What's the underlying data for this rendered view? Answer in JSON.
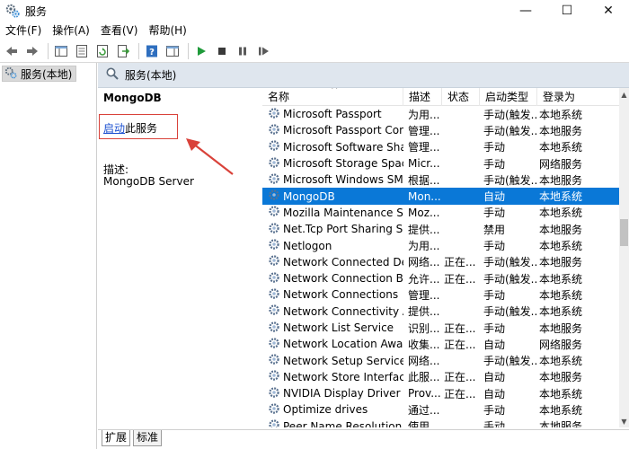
{
  "window": {
    "title": "服务"
  },
  "window_controls": {
    "minimize": "—",
    "maximize": "☐",
    "close": "✕"
  },
  "menu": [
    "文件(F)",
    "操作(A)",
    "查看(V)",
    "帮助(H)"
  ],
  "toolbar": {
    "icons": [
      "back-icon",
      "forward-icon",
      "show-tree-icon",
      "properties-icon",
      "refresh-icon",
      "export-icon",
      "help-icon",
      "show-panel-icon",
      "start-icon",
      "stop-icon",
      "pause-icon",
      "restart-icon"
    ]
  },
  "tree": {
    "root_label": "服务(本地)"
  },
  "pane": {
    "header_label": "服务(本地)"
  },
  "description": {
    "service_name": "MongoDB",
    "action_link": "启动",
    "action_suffix": "此服务",
    "desc_label": "描述:",
    "desc_value": "MongoDB Server"
  },
  "table": {
    "columns": [
      "名称",
      "描述",
      "状态",
      "启动类型",
      "登录为"
    ],
    "rows": [
      {
        "name": "Microsoft Passport",
        "desc": "为用...",
        "status": "",
        "start": "手动(触发...",
        "logon": "本地系统"
      },
      {
        "name": "Microsoft Passport Cont...",
        "desc": "管理...",
        "status": "",
        "start": "手动(触发...",
        "logon": "本地服务"
      },
      {
        "name": "Microsoft Software Shad...",
        "desc": "管理...",
        "status": "",
        "start": "手动",
        "logon": "本地系统"
      },
      {
        "name": "Microsoft Storage Space...",
        "desc": "Micr...",
        "status": "",
        "start": "手动",
        "logon": "网络服务"
      },
      {
        "name": "Microsoft Windows SMS ...",
        "desc": "根据...",
        "status": "",
        "start": "手动(触发...",
        "logon": "本地服务"
      },
      {
        "name": "MongoDB",
        "desc": "Mon...",
        "status": "",
        "start": "自动",
        "logon": "本地系统",
        "selected": true
      },
      {
        "name": "Mozilla Maintenance Ser...",
        "desc": "Moz...",
        "status": "",
        "start": "手动",
        "logon": "本地系统"
      },
      {
        "name": "Net.Tcp Port Sharing Ser...",
        "desc": "提供...",
        "status": "",
        "start": "禁用",
        "logon": "本地服务"
      },
      {
        "name": "Netlogon",
        "desc": "为用...",
        "status": "",
        "start": "手动",
        "logon": "本地系统"
      },
      {
        "name": "Network Connected Devi...",
        "desc": "网络...",
        "status": "正在...",
        "start": "手动(触发...",
        "logon": "本地服务"
      },
      {
        "name": "Network Connection Bro...",
        "desc": "允许...",
        "status": "正在...",
        "start": "手动(触发...",
        "logon": "本地系统"
      },
      {
        "name": "Network Connections",
        "desc": "管理...",
        "status": "",
        "start": "手动",
        "logon": "本地系统"
      },
      {
        "name": "Network Connectivity Ass...",
        "desc": "提供...",
        "status": "",
        "start": "手动(触发...",
        "logon": "本地系统"
      },
      {
        "name": "Network List Service",
        "desc": "识别...",
        "status": "正在...",
        "start": "手动",
        "logon": "本地服务"
      },
      {
        "name": "Network Location Aware...",
        "desc": "收集...",
        "status": "正在...",
        "start": "自动",
        "logon": "网络服务"
      },
      {
        "name": "Network Setup Service",
        "desc": "网络...",
        "status": "",
        "start": "手动(触发...",
        "logon": "本地系统"
      },
      {
        "name": "Network Store Interface ...",
        "desc": "此服...",
        "status": "正在...",
        "start": "自动",
        "logon": "本地服务"
      },
      {
        "name": "NVIDIA Display Driver Se...",
        "desc": "Prov...",
        "status": "正在...",
        "start": "自动",
        "logon": "本地系统"
      },
      {
        "name": "Optimize drives",
        "desc": "通过...",
        "status": "",
        "start": "手动",
        "logon": "本地系统"
      },
      {
        "name": "Peer Name Resolution Pr...",
        "desc": "使用...",
        "status": "",
        "start": "手动",
        "logon": "本地服务"
      }
    ]
  },
  "tabs": [
    "扩展",
    "标准"
  ],
  "colors": {
    "selection": "#0a78d7",
    "header": "#dfe6ee",
    "annotation": "#d9423a",
    "link": "#1a4fd0"
  }
}
